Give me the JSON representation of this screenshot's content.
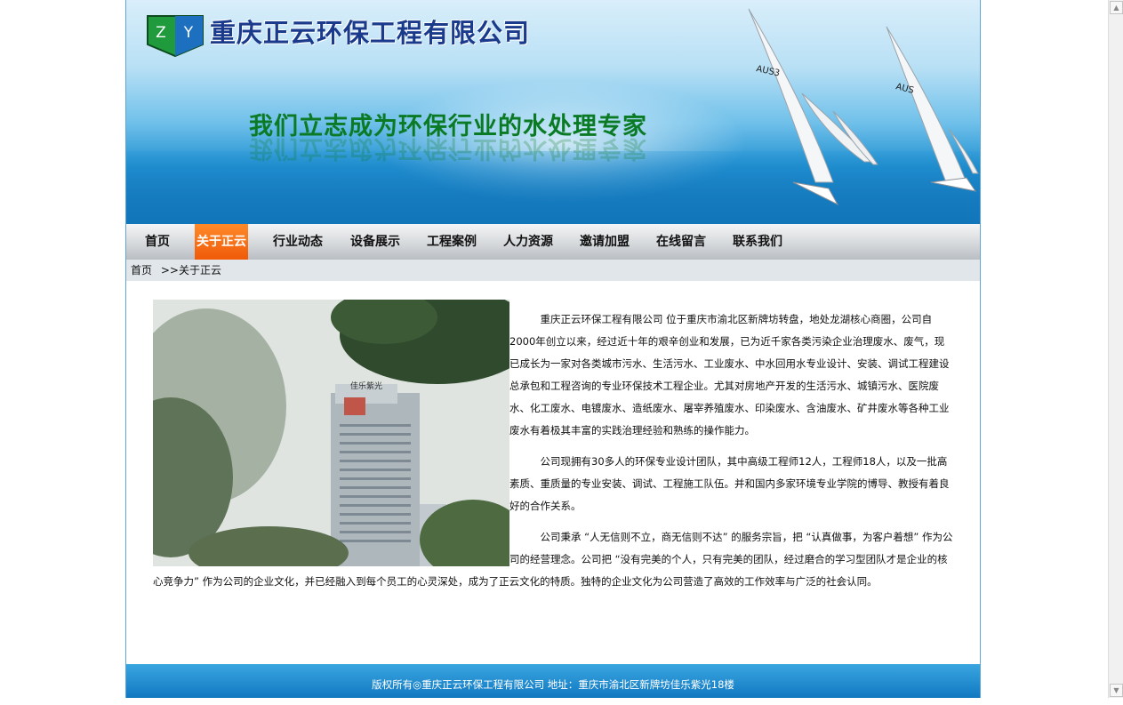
{
  "header": {
    "logo_letters": [
      "Z",
      "Y"
    ],
    "company_name": "重庆正云环保工程有限公司",
    "slogan": "我们立志成为环保行业的水处理专家",
    "sail_numbers": [
      "AUS3",
      "AUS"
    ],
    "building_sign": "佳乐紫光",
    "colors": {
      "logo_green": "#1f9a3c",
      "logo_blue": "#1d6fc0",
      "title_blue": "#1a3a8c",
      "slogan_green": "#0a7a24"
    }
  },
  "nav": {
    "active_index": 1,
    "active_color": "#f05a08",
    "items": [
      "首页",
      "关于正云",
      "行业动态",
      "设备展示",
      "工程案例",
      "人力资源",
      "邀请加盟",
      "在线留言",
      "联系我们"
    ]
  },
  "breadcrumb": {
    "home": "首页",
    "sep": ">>",
    "current": "关于正云"
  },
  "article": {
    "p1": "重庆正云环保工程有限公司 位于重庆市渝北区新牌坊转盘，地处龙湖核心商圈，公司自2000年创立以来，经过近十年的艰辛创业和发展，已为近千家各类污染企业治理废水、废气，现已成长为一家对各类城市污水、生活污水、工业废水、中水回用水专业设计、安装、调试工程建设总承包和工程咨询的专业环保技术工程企业。尤其对房地产开发的生活污水、城镇污水、医院废水、化工废水、电镀废水、造纸废水、屠宰养殖废水、印染废水、含油废水、矿井废水等各种工业废水有着极其丰富的实践治理经验和熟练的操作能力。",
    "p2": "公司现拥有30多人的环保专业设计团队，其中高级工程师12人，工程师18人，以及一批高素质、重质量的专业安装、调试、工程施工队伍。并和国内多家环境专业学院的博导、教授有着良好的合作关系。",
    "p3": "公司秉承 “人无信则不立，商无信则不达” 的服务宗旨，把 “认真做事，为客户着想” 作为公司的经营理念。公司把 “没有完美的个人，只有完美的团队，经过磨合的学习型团队才是企业的核心竞争力” 作为公司的企业文化，并已经融入到每个员工的心灵深处，成为了正云文化的特质。独特的企业文化为公司营造了高效的工作效率与广泛的社会认同。"
  },
  "footer": {
    "text": "版权所有◎重庆正云环保工程有限公司  地址：重庆市渝北区新牌坊佳乐紫光18楼",
    "color": "#1178c1"
  }
}
